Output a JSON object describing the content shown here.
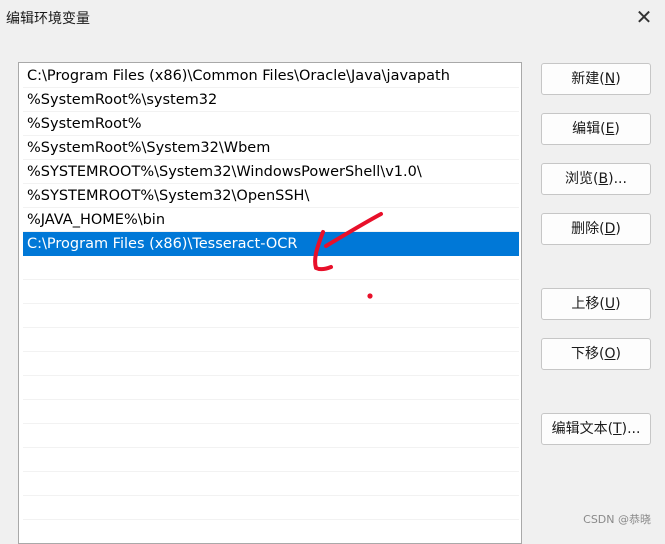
{
  "window": {
    "title": "编辑环境变量",
    "close_glyph": "✕"
  },
  "list": {
    "items": [
      {
        "text": "C:\\Program Files (x86)\\Common Files\\Oracle\\Java\\javapath",
        "selected": false
      },
      {
        "text": "%SystemRoot%\\system32",
        "selected": false
      },
      {
        "text": "%SystemRoot%",
        "selected": false
      },
      {
        "text": "%SystemRoot%\\System32\\Wbem",
        "selected": false
      },
      {
        "text": "%SYSTEMROOT%\\System32\\WindowsPowerShell\\v1.0\\",
        "selected": false
      },
      {
        "text": "%SYSTEMROOT%\\System32\\OpenSSH\\",
        "selected": false
      },
      {
        "text": "%JAVA_HOME%\\bin",
        "selected": false
      },
      {
        "text": "C:\\Program Files (x86)\\Tesseract-OCR",
        "selected": true
      }
    ]
  },
  "buttons": {
    "new": {
      "label": "新建(",
      "key": "N",
      "end": ")"
    },
    "edit": {
      "label": "编辑(",
      "key": "E",
      "end": ")"
    },
    "browse": {
      "label": "浏览(",
      "key": "B",
      "end": ")..."
    },
    "delete": {
      "label": "删除(",
      "key": "D",
      "end": ")"
    },
    "move_up": {
      "label": "上移(",
      "key": "U",
      "end": ")"
    },
    "move_down": {
      "label": "下移(",
      "key": "O",
      "end": ")"
    },
    "edit_text": {
      "label": "编辑文本(",
      "key": "T",
      "end": ")..."
    }
  },
  "colors": {
    "selection": "#0078d7",
    "annotation": "#e8102a"
  },
  "watermark": "CSDN @恭晓"
}
